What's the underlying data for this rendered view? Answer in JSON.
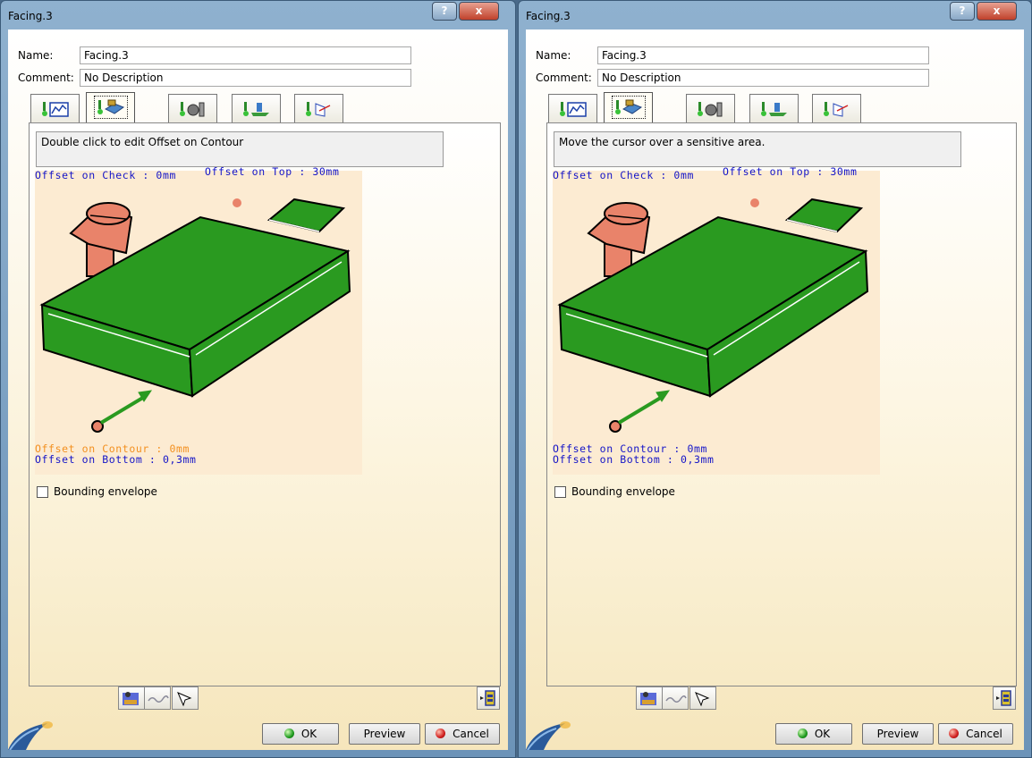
{
  "dialogs": [
    {
      "title": "Facing.3",
      "help_label": "?",
      "close_label": "x",
      "name_label": "Name:",
      "name_value": "Facing.3",
      "comment_label": "Comment:",
      "comment_value": "No Description",
      "message": "Double click to edit Offset on Contour",
      "offset_check": "Offset on Check : 0mm",
      "offset_top": "Offset on Top : 30mm",
      "offset_contour": "Offset on Contour : 0mm",
      "offset_bottom": "Offset on Bottom : 0,3mm",
      "contour_highlighted": true,
      "checkbox_label": "Bounding envelope",
      "ok_label": "OK",
      "preview_label": "Preview",
      "cancel_label": "Cancel"
    },
    {
      "title": "Facing.3",
      "help_label": "?",
      "close_label": "x",
      "name_label": "Name:",
      "name_value": "Facing.3",
      "comment_label": "Comment:",
      "comment_value": "No Description",
      "message": "Move the cursor over a sensitive area.",
      "offset_check": "Offset on Check : 0mm",
      "offset_top": "Offset on Top : 30mm",
      "offset_contour": "Offset on Contour : 0mm",
      "offset_bottom": "Offset on Bottom : 0,3mm",
      "contour_highlighted": false,
      "checkbox_label": "Bounding envelope",
      "ok_label": "OK",
      "preview_label": "Preview",
      "cancel_label": "Cancel"
    }
  ],
  "tabs": [
    {
      "icon": "strategy-tab-icon"
    },
    {
      "icon": "geometry-tab-icon",
      "active": true
    },
    {
      "icon": "tool-tab-icon"
    },
    {
      "icon": "feeds-speeds-tab-icon"
    },
    {
      "icon": "macros-tab-icon"
    }
  ],
  "colors": {
    "part_green": "#2a9a20",
    "clamp_salmon": "#e9836a",
    "label_blue": "#1515c8",
    "label_orange": "#f39020",
    "image_bg": "#fcebd2"
  }
}
